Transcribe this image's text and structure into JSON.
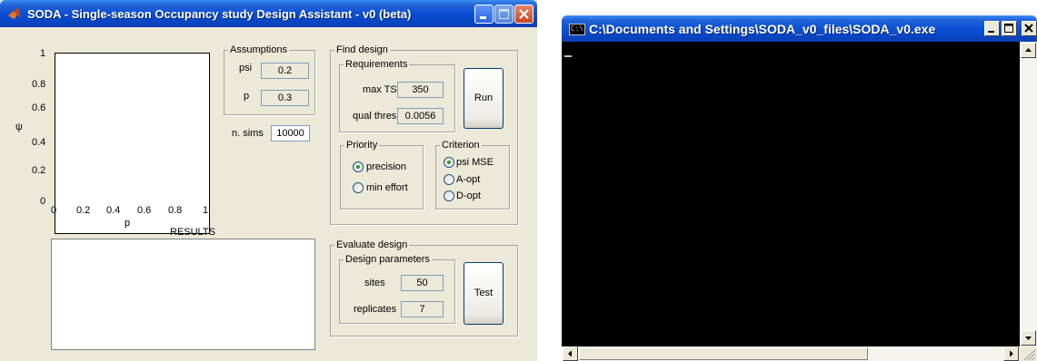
{
  "soda": {
    "title": "SODA - Single-season Occupancy study Design Assistant - v0 (beta)",
    "plot": {
      "y_ticks": [
        "1",
        "0.8",
        "0.6",
        "0.4",
        "0.2",
        "0"
      ],
      "x_ticks": [
        "0",
        "0.2",
        "0.4",
        "0.6",
        "0.8",
        "1"
      ],
      "ylabel": "ψ",
      "xlabel": "p"
    },
    "results_label": "RESULTS",
    "assumptions": {
      "legend": "Assumptions",
      "psi_label": "psi",
      "psi_value": "0.2",
      "p_label": "p",
      "p_value": "0.3"
    },
    "nsims": {
      "label": "n. sims",
      "value": "10000"
    },
    "find_design": {
      "legend": "Find design",
      "requirements": {
        "legend": "Requirements",
        "maxts_label": "max TS",
        "maxts_value": "350",
        "qual_label": "qual thres",
        "qual_value": "0.0056"
      },
      "run_label": "Run",
      "priority": {
        "legend": "Priority",
        "options": [
          {
            "label": "precision",
            "selected": true
          },
          {
            "label": "min effort",
            "selected": false
          }
        ]
      },
      "criterion": {
        "legend": "Criterion",
        "options": [
          {
            "label": "psi MSE",
            "selected": true
          },
          {
            "label": "A-opt",
            "selected": false
          },
          {
            "label": "D-opt",
            "selected": false
          }
        ]
      }
    },
    "evaluate_design": {
      "legend": "Evaluate design",
      "params": {
        "legend": "Design parameters",
        "sites_label": "sites",
        "sites_value": "50",
        "replicates_label": "replicates",
        "replicates_value": "7"
      },
      "test_label": "Test"
    }
  },
  "console": {
    "title": "C:\\Documents and Settings\\SODA_v0_files\\SODA_v0.exe",
    "icon_text": "C:\\"
  }
}
